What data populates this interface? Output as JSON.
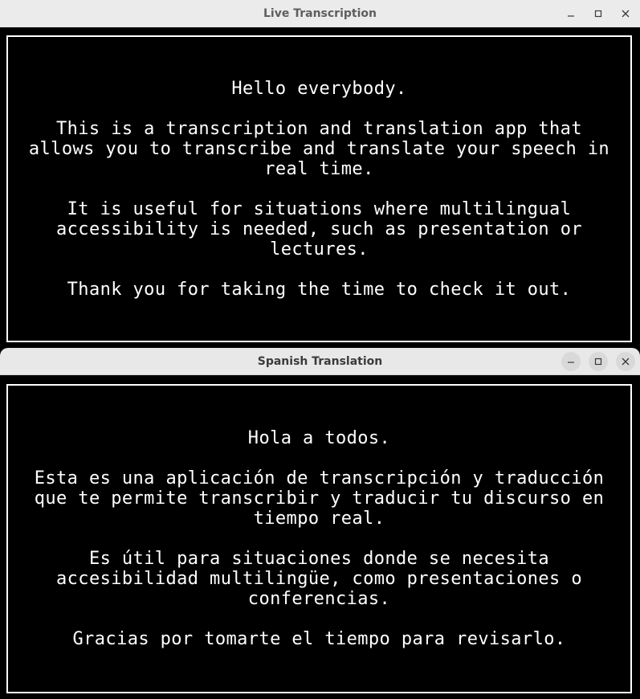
{
  "transcription_window": {
    "title": "Live Transcription",
    "paragraphs": [
      "Hello everybody.",
      "This is a transcription and translation app that\nallows you to transcribe and translate your speech in\nreal time.",
      "It is useful for situations where multilingual\naccessibility is needed, such as presentation or\nlectures.",
      "Thank you for taking the time to check it out."
    ]
  },
  "translation_window": {
    "title": "Spanish Translation",
    "paragraphs": [
      "Hola a todos.",
      "Esta es una aplicación de transcripción y traducción\nque te permite transcribir y traducir tu discurso en\ntiempo real.",
      "Es útil para situaciones donde se necesita\naccesibilidad multilingüe, como presentaciones o\nconferencias.",
      "Gracias por tomarte el tiempo para revisarlo."
    ]
  },
  "window_controls": {
    "minimize_icon": "minimize-icon",
    "maximize_icon": "maximize-icon",
    "close_icon": "close-icon"
  },
  "colors": {
    "titlebar": "#ebebeb",
    "content_background": "#000000",
    "text": "#ffffff",
    "border": "#ffffff"
  }
}
